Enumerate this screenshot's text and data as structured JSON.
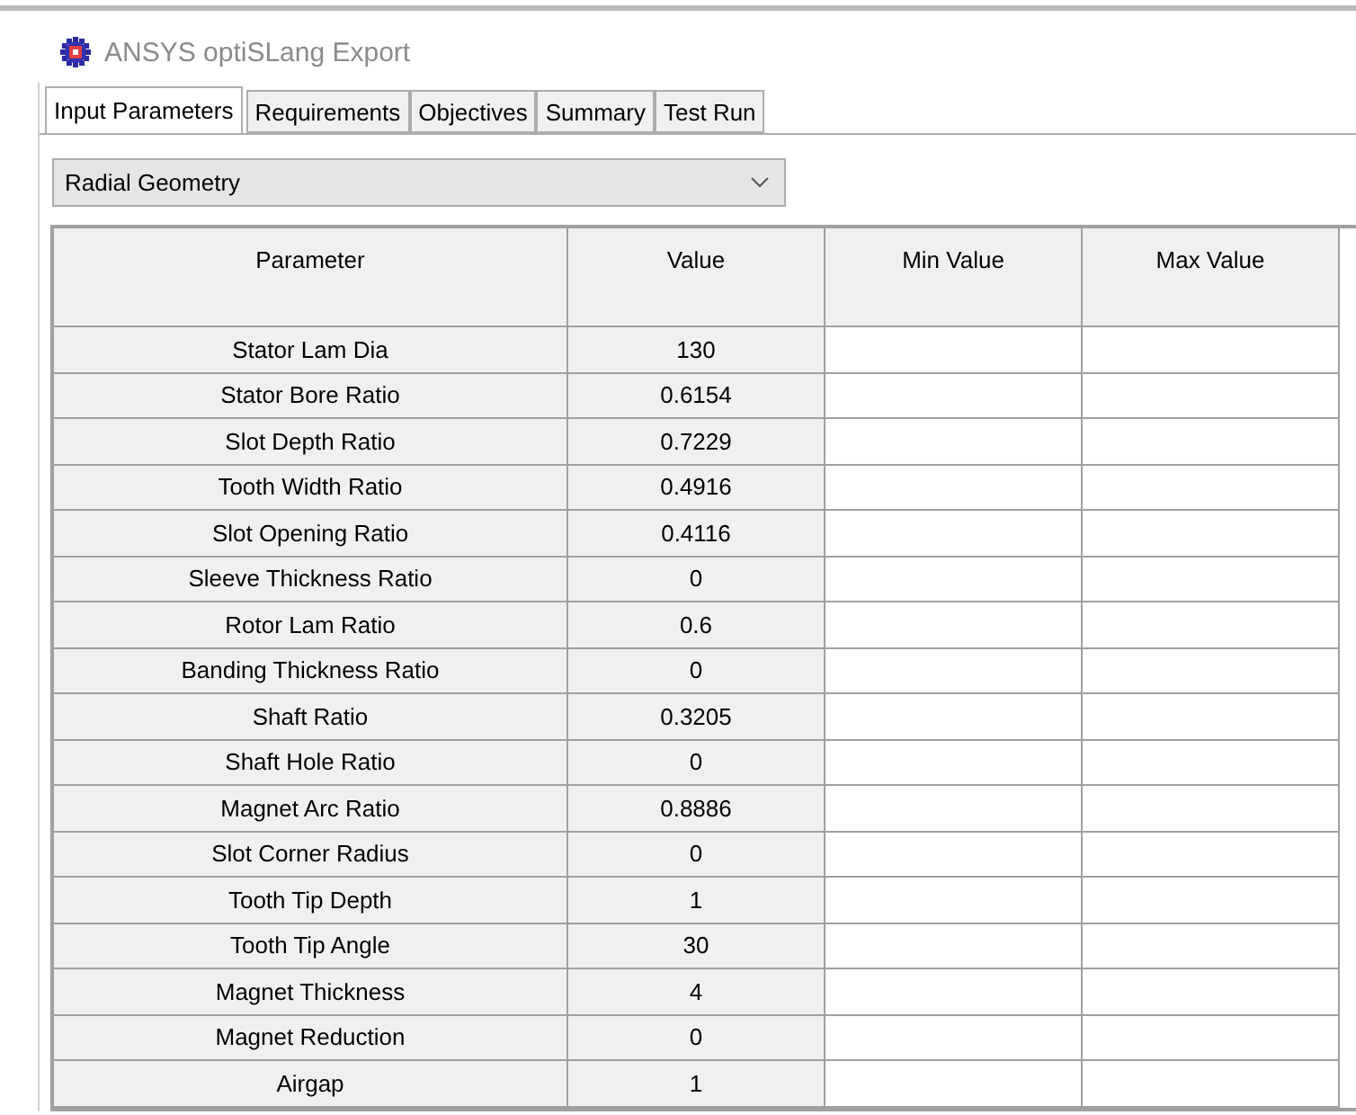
{
  "window": {
    "title": "ANSYS optiSLang Export"
  },
  "tabs": [
    {
      "label": "Input Parameters",
      "selected": true
    },
    {
      "label": "Requirements",
      "selected": false
    },
    {
      "label": "Objectives",
      "selected": false
    },
    {
      "label": "Summary",
      "selected": false
    },
    {
      "label": "Test Run",
      "selected": false
    }
  ],
  "category_select": {
    "value": "Radial Geometry"
  },
  "table": {
    "columns": [
      "Parameter",
      "Value",
      "Min Value",
      "Max Value"
    ],
    "rows": [
      {
        "parameter": "Stator Lam Dia",
        "value": "130"
      },
      {
        "parameter": "Stator Bore Ratio",
        "value": "0.6154"
      },
      {
        "parameter": "Slot Depth Ratio",
        "value": "0.7229"
      },
      {
        "parameter": "Tooth Width Ratio",
        "value": "0.4916"
      },
      {
        "parameter": "Slot Opening Ratio",
        "value": "0.4116"
      },
      {
        "parameter": "Sleeve Thickness Ratio",
        "value": "0"
      },
      {
        "parameter": "Rotor Lam Ratio",
        "value": "0.6"
      },
      {
        "parameter": "Banding Thickness Ratio",
        "value": "0"
      },
      {
        "parameter": "Shaft Ratio",
        "value": "0.3205"
      },
      {
        "parameter": "Shaft Hole Ratio",
        "value": "0"
      },
      {
        "parameter": "Magnet Arc Ratio",
        "value": "0.8886"
      },
      {
        "parameter": "Slot Corner Radius",
        "value": "0"
      },
      {
        "parameter": "Tooth Tip Depth",
        "value": "1"
      },
      {
        "parameter": "Tooth Tip Angle",
        "value": "30"
      },
      {
        "parameter": "Magnet Thickness",
        "value": "4"
      },
      {
        "parameter": "Magnet Reduction",
        "value": "0"
      },
      {
        "parameter": "Airgap",
        "value": "1"
      }
    ]
  }
}
